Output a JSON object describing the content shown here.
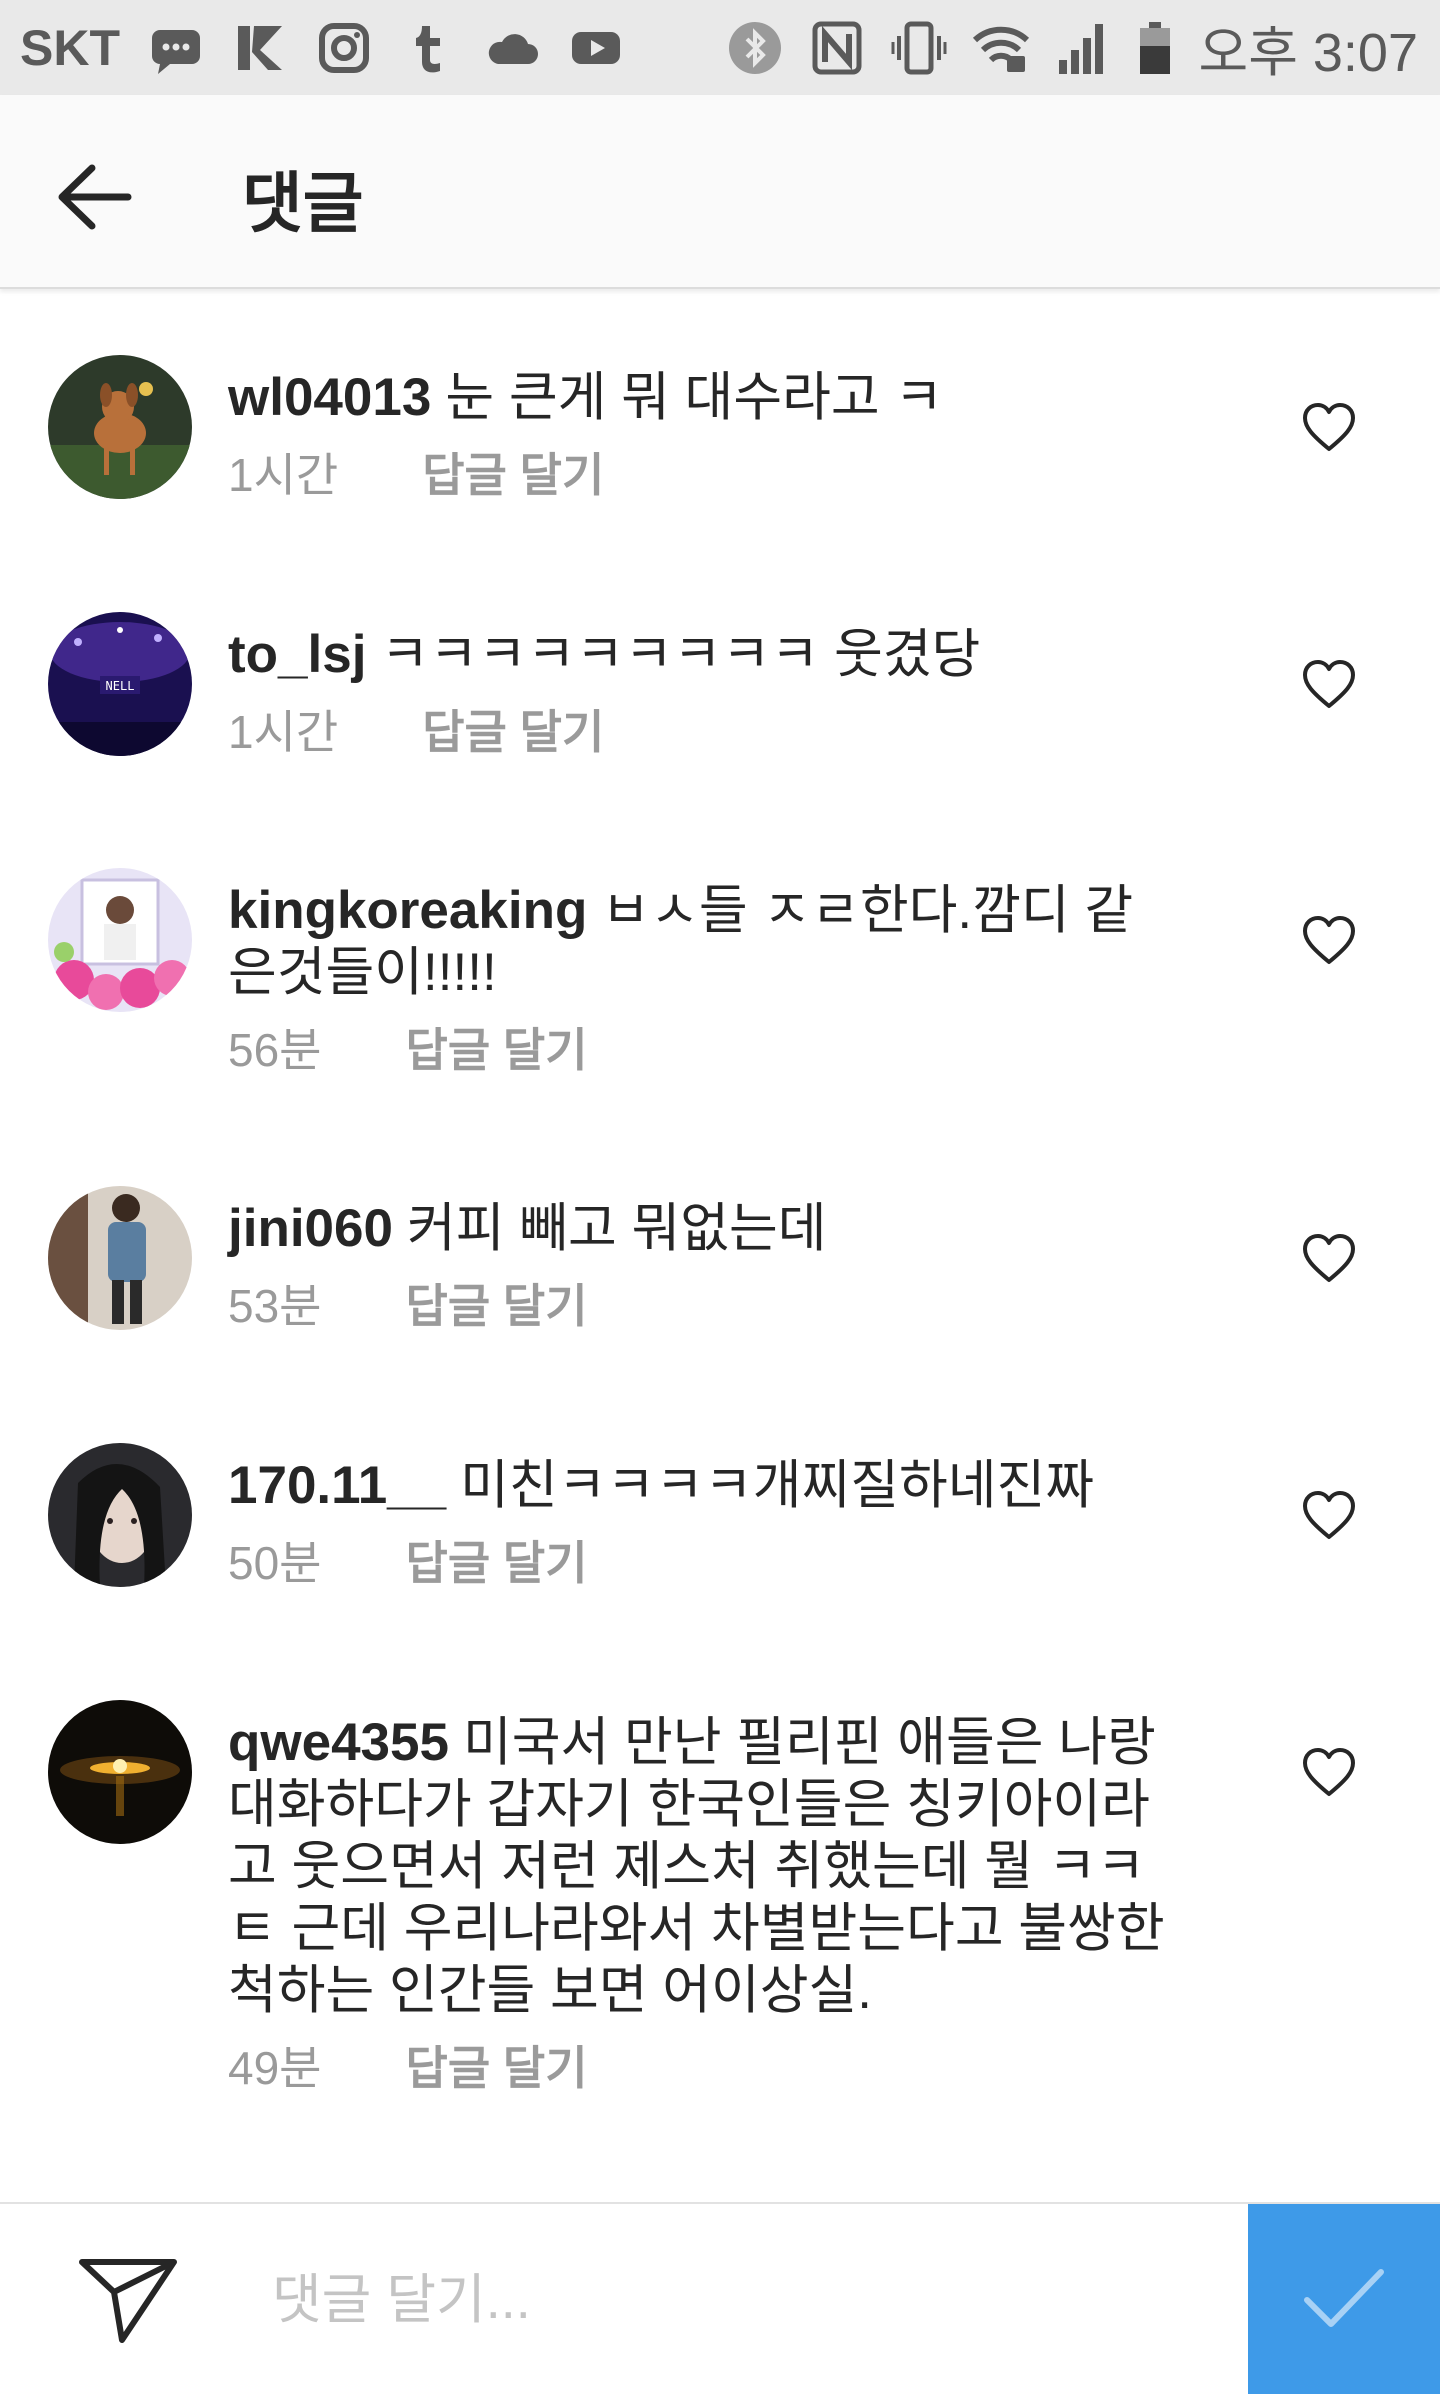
{
  "status_bar": {
    "carrier": "SKT",
    "time": "오후 3:07",
    "icons": [
      "message-icon",
      "kakao-icon",
      "instagram-icon",
      "tumblr-icon",
      "cloud-icon",
      "youtube-icon",
      "bluetooth-icon",
      "nfc-icon",
      "vibrate-icon",
      "wifi-icon",
      "signal-icon",
      "battery-icon"
    ]
  },
  "header": {
    "title": "댓글"
  },
  "comments": [
    {
      "username": "wl04013",
      "text": "눈 큰게 뭐 대수라고 ㅋ",
      "time": "1시간",
      "reply": "답글 달기"
    },
    {
      "username": "to_lsj",
      "text": "ㅋㅋㅋㅋㅋㅋㅋㅋㅋ 웃겼당",
      "time": "1시간",
      "reply": "답글 달기"
    },
    {
      "username": "kingkoreaking",
      "text": "ㅂㅅ들 ㅈㄹ한다.깜디 같은것들이!!!!!",
      "time": "56분",
      "reply": "답글 달기"
    },
    {
      "username": "jini060",
      "text": "커피 빼고 뭐없는데",
      "time": "53분",
      "reply": "답글 달기"
    },
    {
      "username": "170.11__",
      "text": "미친ㅋㅋㅋㅋ개찌질하네진짜",
      "time": "50분",
      "reply": "답글 달기"
    },
    {
      "username": "qwe4355",
      "text": "미국서 만난 필리핀 애들은 나랑 대화하다가 갑자기 한국인들은 칭키아이라고 웃으면서 저런 제스처 취했는데 뭘 ㅋㅋㅌ 근데 우리나라와서 차별받는다고 불쌍한척하는 인간들 보면 어이상실.",
      "time": "49분",
      "reply": "답글 달기"
    }
  ],
  "input_bar": {
    "placeholder": "댓글 달기..."
  },
  "colors": {
    "accent": "#3e9ae8",
    "status_bar_bg": "#e9e9e9",
    "meta_text": "#9a9a9a"
  }
}
